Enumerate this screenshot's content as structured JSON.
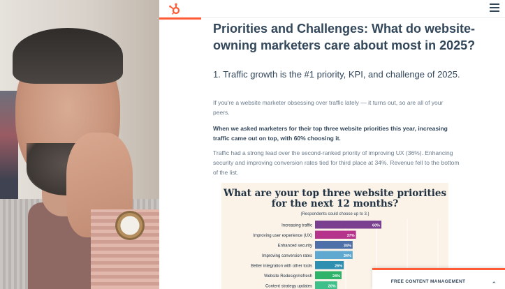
{
  "header": {
    "logo_icon": "hubspot-sprocket-icon",
    "menu_icon": "hamburger-menu-icon",
    "accent_color": "#ff5c35"
  },
  "article": {
    "title": "Priorities and Challenges: What do website-owning marketers care about most in 2025?",
    "subtitle": "1. Traffic growth is the #1 priority, KPI, and challenge of 2025.",
    "paragraph_1": "If you're a website marketer obsessing over traffic lately — it turns out, so are all of your peers.",
    "paragraph_2": "When we asked marketers for their top three website priorities this year, increasing traffic came out on top, with 60% choosing it.",
    "paragraph_3": "Traffic had a strong lead over the second-ranked priority of improving UX (36%). Enhancing security and improving conversion rates tied for third place at 34%. Revenue fell to the bottom of the list."
  },
  "chart_data": {
    "type": "bar",
    "orientation": "horizontal",
    "title": "What are your top three website priorities for the next 12 months?",
    "subtitle": "(Respondents could choose up to 3.)",
    "categories": [
      "Increasing traffic",
      "Improving user experience (UX)",
      "Enhanced security",
      "Improving conversion rates",
      "Better integration with other tools",
      "Website Redesign/refresh",
      "Content strategy updates"
    ],
    "values": [
      60,
      37,
      34,
      34,
      26,
      24,
      20
    ],
    "value_labels": [
      "60%",
      "37%",
      "34%",
      "34%",
      "26%",
      "24%",
      "20%"
    ],
    "bar_colors": [
      "#7a3f8f",
      "#b5338a",
      "#4f6fa8",
      "#5fa8cf",
      "#2f8fb0",
      "#2fb36a",
      "#3fbf8a"
    ],
    "xlim": [
      0,
      100
    ],
    "grid": true
  },
  "popup": {
    "text": "FREE CONTENT MANAGEMENT",
    "chevron_icon": "chevron-up-icon"
  }
}
